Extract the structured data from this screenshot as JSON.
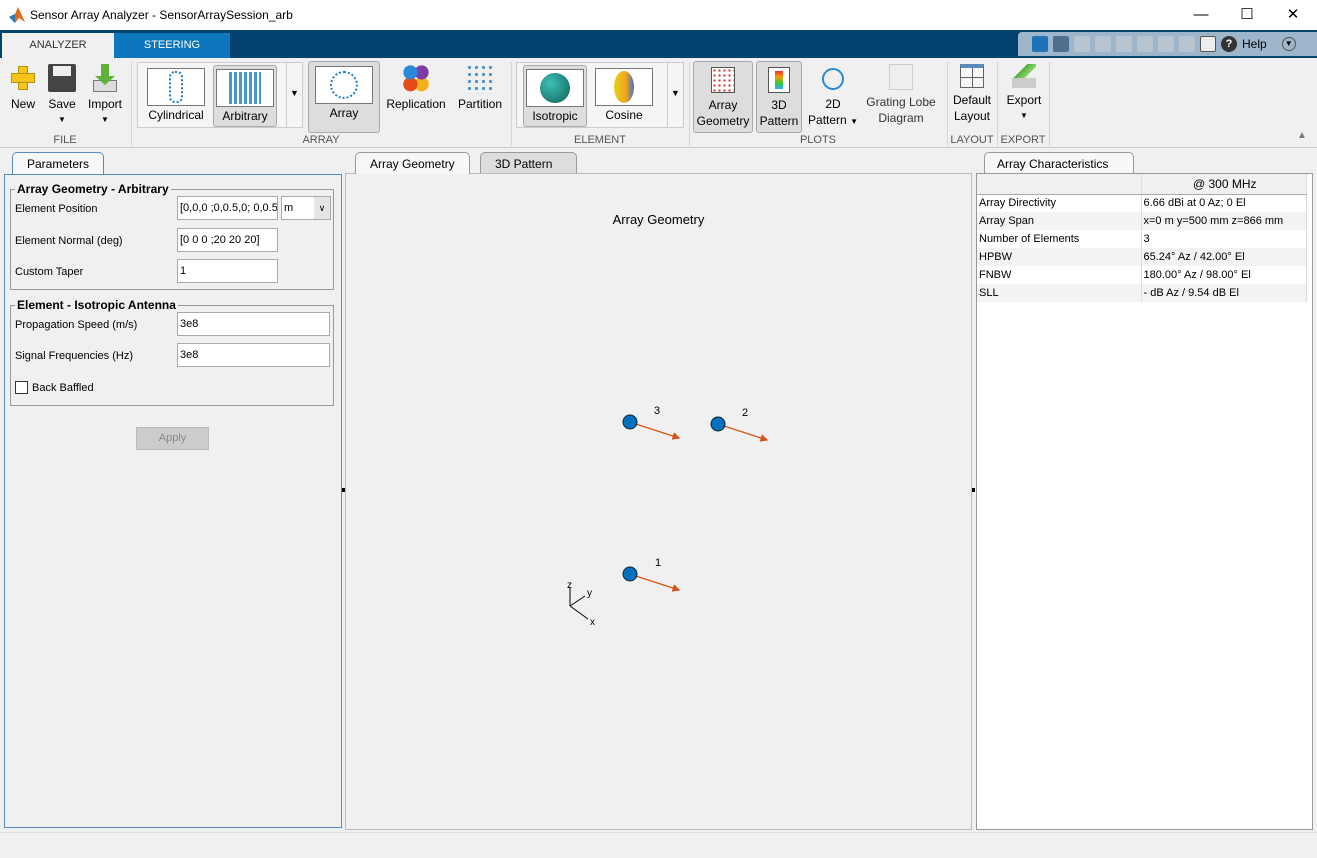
{
  "window": {
    "title": "Sensor Array Analyzer - SensorArraySession_arb",
    "minimize": "—",
    "maximize": "☐",
    "close": "✕"
  },
  "ribbon_tabs": [
    {
      "label": "ANALYZER",
      "active": true
    },
    {
      "label": "STEERING",
      "active": false
    }
  ],
  "quick_access": {
    "help": "Help"
  },
  "ribbon": {
    "file": {
      "section": "FILE",
      "new": "New",
      "save": "Save",
      "import": "Import"
    },
    "array": {
      "section": "ARRAY",
      "gallery": [
        "Cylindrical",
        "Arbitrary"
      ],
      "selected": "Arbitrary",
      "array": "Array",
      "replication": "Replication",
      "partition": "Partition"
    },
    "element": {
      "section": "ELEMENT",
      "gallery": [
        "Isotropic",
        "Cosine"
      ],
      "selected": "Isotropic"
    },
    "plots": {
      "section": "PLOTS",
      "array_geometry": [
        "Array",
        "Geometry"
      ],
      "pattern3d": [
        "3D",
        "Pattern"
      ],
      "pattern2d": [
        "2D",
        "Pattern"
      ],
      "grating": [
        "Grating Lobe",
        "Diagram"
      ]
    },
    "layout": {
      "section": "LAYOUT",
      "default": [
        "Default",
        "Layout"
      ]
    },
    "export": {
      "section": "EXPORT",
      "export": "Export"
    }
  },
  "parameters": {
    "tab": "Parameters",
    "geometry": {
      "legend": "Array Geometry - Arbitrary",
      "element_position_label": "Element Position",
      "element_position": "[0,0,0 ;0,0.5,0; 0,0.5",
      "unit": "m",
      "element_normal_label": "Element Normal (deg)",
      "element_normal": "[0 0 0 ;20 20 20]",
      "custom_taper_label": "Custom Taper",
      "custom_taper": "1"
    },
    "element": {
      "legend": "Element - Isotropic Antenna",
      "speed_label": "Propagation Speed (m/s)",
      "speed": "3e8",
      "freq_label": "Signal Frequencies (Hz)",
      "freq": "3e8",
      "back_baffled_label": "Back Baffled",
      "back_baffled": false
    },
    "apply": "Apply"
  },
  "plot": {
    "tabs": [
      "Array Geometry",
      "3D Pattern"
    ],
    "active_tab": "Array Geometry",
    "title": "Array Geometry",
    "elements": [
      {
        "label": "1"
      },
      {
        "label": "2"
      },
      {
        "label": "3"
      }
    ],
    "axes": {
      "x": "x",
      "y": "y",
      "z": "z"
    },
    "colors": {
      "element": "#0072bd",
      "normal": "#d95319"
    }
  },
  "characteristics": {
    "tab": "Array Characteristics",
    "header": "@ 300 MHz",
    "rows": [
      [
        "Array Directivity",
        "6.66 dBi at 0 Az; 0 El"
      ],
      [
        "Array Span",
        "x=0 m y=500 mm z=866 mm"
      ],
      [
        "Number of Elements",
        "3"
      ],
      [
        "HPBW",
        "65.24° Az / 42.00° El"
      ],
      [
        "FNBW",
        "180.00° Az / 98.00° El"
      ],
      [
        "SLL",
        "- dB Az / 9.54 dB El"
      ]
    ]
  }
}
